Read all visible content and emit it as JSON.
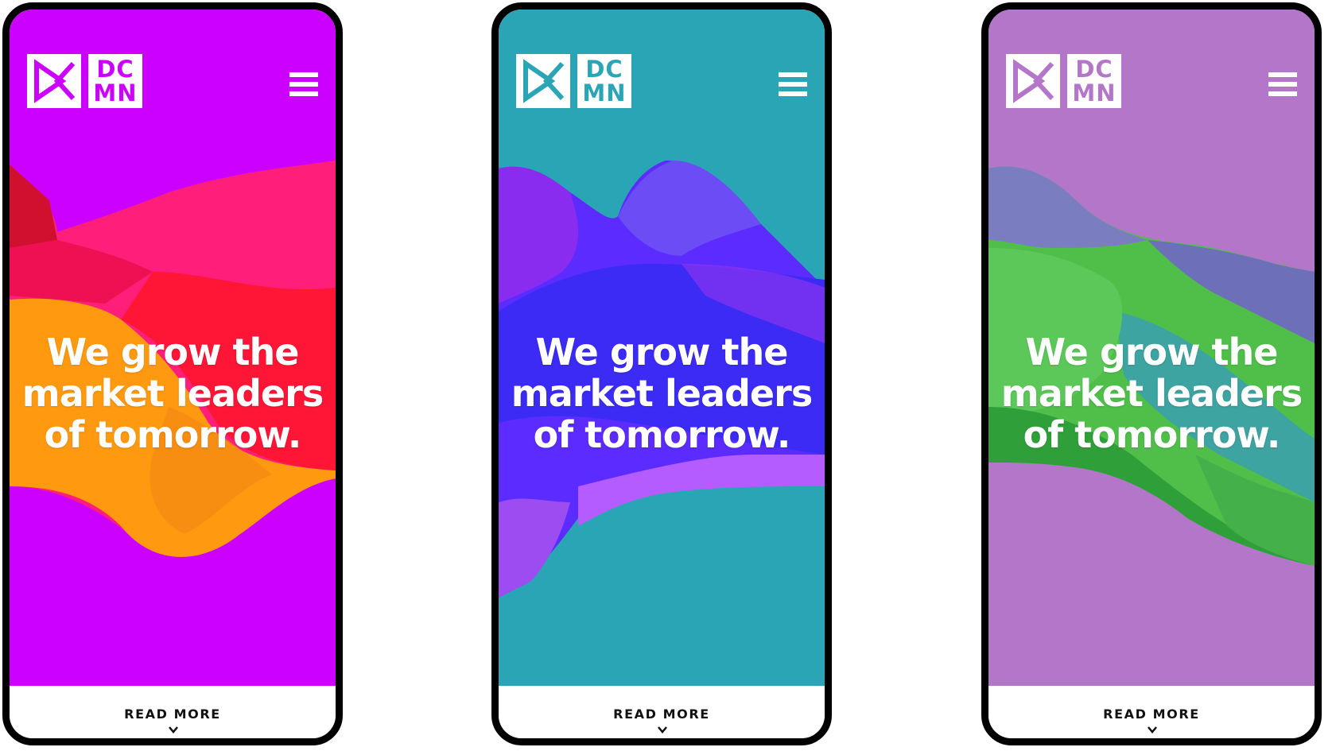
{
  "logo": {
    "line1": "DC",
    "line2": "MN"
  },
  "headline": {
    "line1": "We grow the",
    "line2": "market leaders",
    "line3": "of tomorrow."
  },
  "cta": {
    "label": "READ MORE"
  },
  "phones": [
    {
      "background": "#cc00ff",
      "logo_color": "#cc00ff",
      "art": "pink-orange-ribbon"
    },
    {
      "background": "#2aa5b5",
      "logo_color": "#2aa5b5",
      "art": "blue-violet-ribbon"
    },
    {
      "background": "#b376c8",
      "logo_color": "#b376c8",
      "art": "green-teal-ribbon"
    }
  ],
  "icons": {
    "menu": "hamburger-menu-icon",
    "scroll": "chevron-down-icon",
    "brand": "dcmn-logo-mark"
  }
}
